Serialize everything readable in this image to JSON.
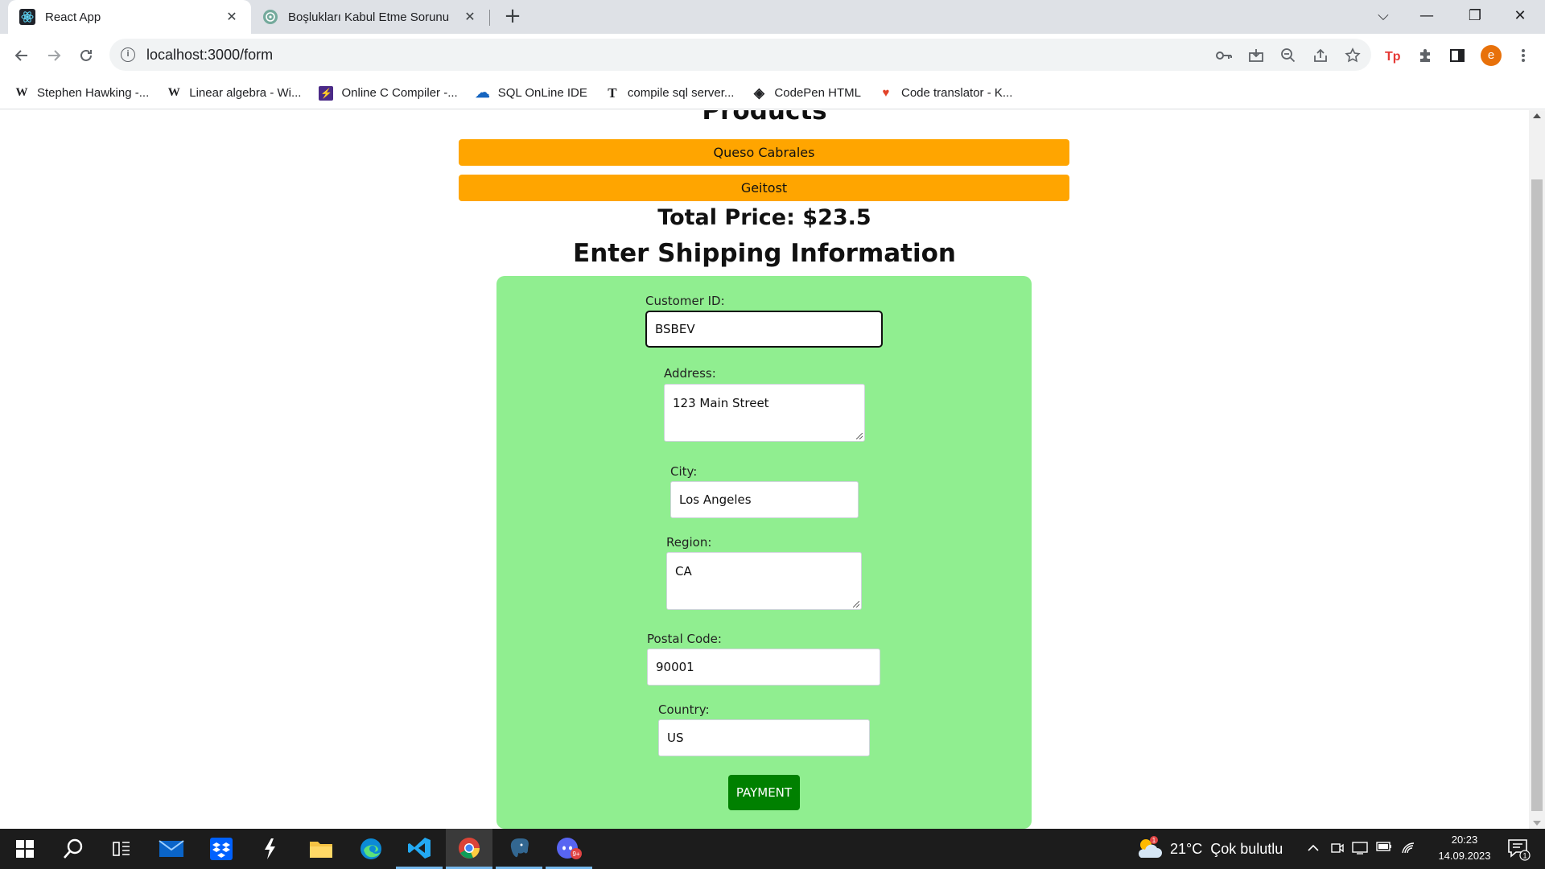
{
  "browser": {
    "tabs": [
      {
        "title": "React App",
        "active": true,
        "favicon": "react-icon"
      },
      {
        "title": "Boşlukları Kabul Etme Sorunu",
        "active": false,
        "favicon": "chatgpt-icon"
      }
    ],
    "close_glyph": "✕",
    "new_tab_glyph": "+",
    "window_controls": {
      "dropdown": "⌵",
      "minimize": "—",
      "restore": "❐",
      "close": "✕"
    },
    "url": "localhost:3000/form",
    "info_glyph": "i",
    "profile_initial": "e",
    "bookmarks": [
      {
        "label": "Stephen Hawking -...",
        "icon": "wikipedia-icon",
        "glyph": "W"
      },
      {
        "label": "Linear algebra - Wi...",
        "icon": "wikipedia-icon",
        "glyph": "W"
      },
      {
        "label": "Online C Compiler -...",
        "icon": "lightning-icon",
        "glyph": "⚡"
      },
      {
        "label": "SQL OnLine IDE",
        "icon": "sql-cloud-icon",
        "glyph": "☁"
      },
      {
        "label": "compile sql server...",
        "icon": "t-letter-icon",
        "glyph": "T"
      },
      {
        "label": "CodePen HTML",
        "icon": "codepen-icon",
        "glyph": "◈"
      },
      {
        "label": "Code translator - K...",
        "icon": "fox-icon",
        "glyph": "♥"
      }
    ]
  },
  "page": {
    "products_title": "Products",
    "products": [
      "Queso Cabrales",
      "Geitost"
    ],
    "total_price": "Total Price: $23.5",
    "shipping_title": "Enter Shipping Information",
    "form": {
      "customer_id": {
        "label": "Customer ID:",
        "value": "BSBEV"
      },
      "address": {
        "label": "Address:",
        "value": "123 Main Street"
      },
      "city": {
        "label": "City:",
        "value": "Los Angeles"
      },
      "region": {
        "label": "Region:",
        "value": "CA"
      },
      "postal_code": {
        "label": "Postal Code:",
        "value": "90001"
      },
      "country": {
        "label": "Country:",
        "value": "US"
      }
    },
    "payment_label": "PAYMENT",
    "colors": {
      "product_button": "#ffa500",
      "form_background": "#90ee90",
      "payment_button": "#008000"
    }
  },
  "taskbar": {
    "apps": [
      "start-icon",
      "search-icon",
      "task-view-icon",
      "mail-icon",
      "dropbox-icon",
      "nvidia-icon",
      "file-explorer-icon",
      "edge-icon",
      "vscode-icon",
      "chrome-icon",
      "postgresql-icon",
      "discord-icon"
    ],
    "weather_badge": "1",
    "weather": "21°C  Çok bulutlu",
    "discord_badge": "9+",
    "time": "20:23",
    "date": "14.09.2023",
    "notification_count": "1"
  }
}
